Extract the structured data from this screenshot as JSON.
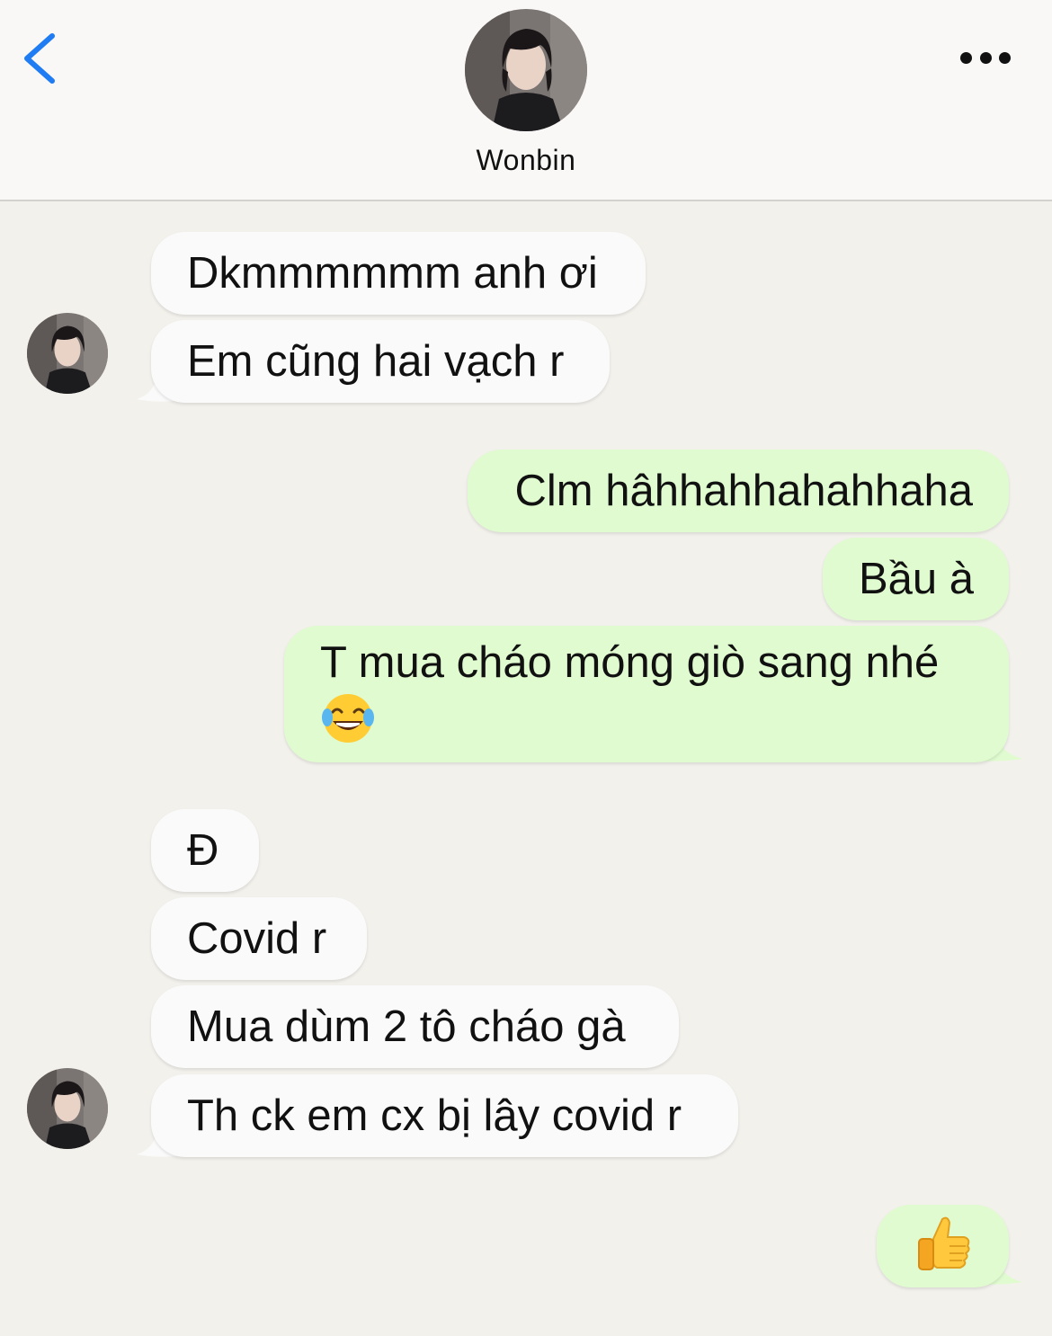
{
  "header": {
    "contact_name": "Wonbin"
  },
  "messages": [
    {
      "direction": "incoming",
      "text": "Dkmmmmmm anh ơi"
    },
    {
      "direction": "incoming",
      "text": "Em cũng hai vạch r"
    },
    {
      "direction": "outgoing",
      "text": "Clm hâhhahhahahhaha"
    },
    {
      "direction": "outgoing",
      "text": "Bầu à"
    },
    {
      "direction": "outgoing",
      "text": "T mua cháo móng giò sang nhé",
      "emoji": "tears-of-joy-emoji"
    },
    {
      "direction": "incoming",
      "text": "Đ"
    },
    {
      "direction": "incoming",
      "text": "Covid r"
    },
    {
      "direction": "incoming",
      "text": "Mua dùm 2 tô cháo gà"
    },
    {
      "direction": "incoming",
      "text": "Th ck em cx bị lây covid r"
    },
    {
      "direction": "outgoing",
      "emoji": "thumbs-up-emoji"
    }
  ],
  "colors": {
    "background": "#f3f1ec",
    "header_background": "#f9f8f6",
    "incoming_bubble": "#fafafa",
    "outgoing_bubble": "#e0fbd0",
    "accent_blue": "#1f7cf2"
  },
  "icons": {
    "back": "chevron-left-icon",
    "more": "more-dots-icon"
  }
}
